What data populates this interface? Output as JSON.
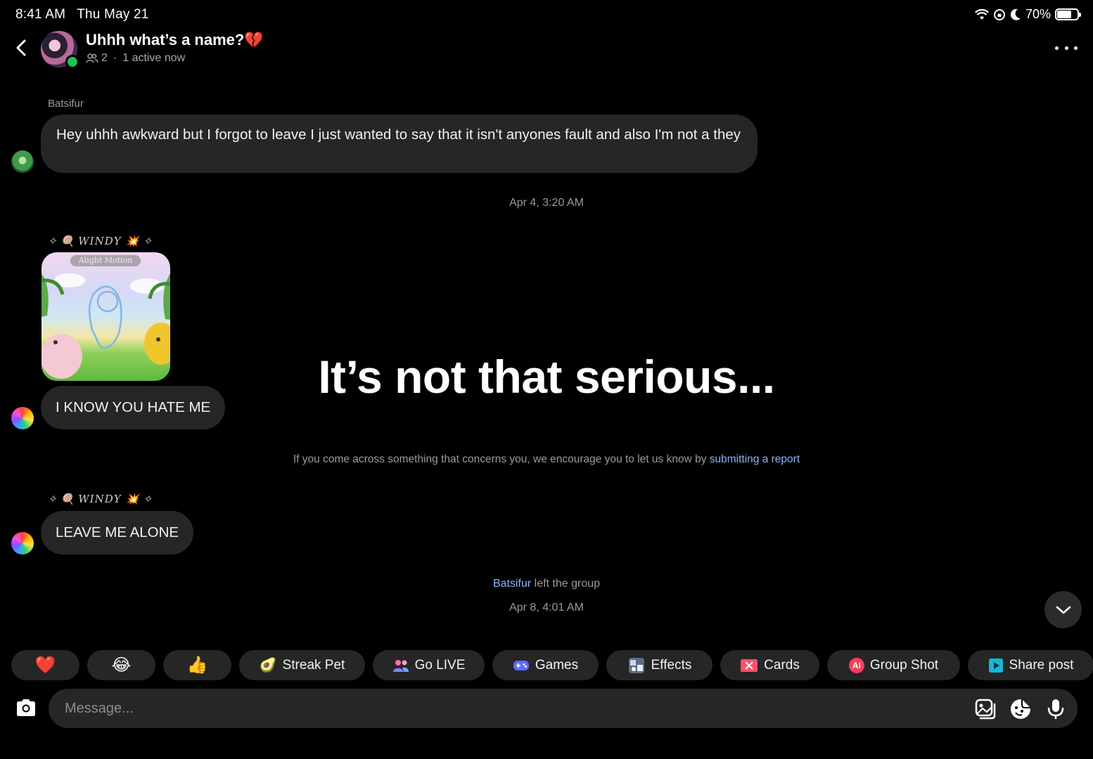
{
  "status_bar": {
    "time": "8:41 AM",
    "date": "Thu May 21",
    "battery": "70%",
    "battery_level": 0.7
  },
  "header": {
    "title": "Uhhh what’s a name?💔",
    "member_count": "2",
    "separator": "·",
    "active_status": "1 active now",
    "icons": [
      "back-chevron-icon",
      "group-avatar",
      "people-icon",
      "more-options-icon"
    ]
  },
  "messages": [
    {
      "sender": "Batsifur",
      "text": "Hey uhhh awkward but I forgot to leave I just wanted to say that it isn't anyones fault and also I'm not a they"
    },
    {
      "timestamp": "Apr 4, 3:20 AM"
    },
    {
      "sender": "WINDY",
      "sender_emojis": [
        "✧",
        "🍭",
        "💥",
        "✧"
      ],
      "media_badge": "Alight Motion",
      "text": "I KNOW YOU HATE ME"
    },
    {
      "sender": "WINDY",
      "text": "LEAVE ME ALONE"
    }
  ],
  "overlay": {
    "headline": "It’s not that serious...",
    "report_text": "If you come across something that concerns you, we encourage you to let us know by",
    "report_link": "submitting a report"
  },
  "system_event": {
    "name": "Batsifur",
    "text": "left the group",
    "timestamp": "Apr 8, 4:01 AM"
  },
  "chips": {
    "heart": "❤️",
    "laugh": "😂",
    "thumbs": "👍",
    "streak_pet_emoji": "🥑",
    "streak_pet": "Streak Pet",
    "go_live": "Go LIVE",
    "games": "Games",
    "effects": "Effects",
    "cards": "Cards",
    "group_shot_badge": "AI",
    "group_shot": "Group Shot",
    "share_post": "Share post"
  },
  "composer": {
    "placeholder": "Message...",
    "icons": [
      "camera-icon",
      "gallery-icon",
      "sticker-icon",
      "microphone-icon"
    ]
  },
  "colors": {
    "background": "#000000",
    "bubble": "#262626",
    "link": "#8ab4f8",
    "online": "#21c04f",
    "muted_text": "#9a9a9a"
  }
}
